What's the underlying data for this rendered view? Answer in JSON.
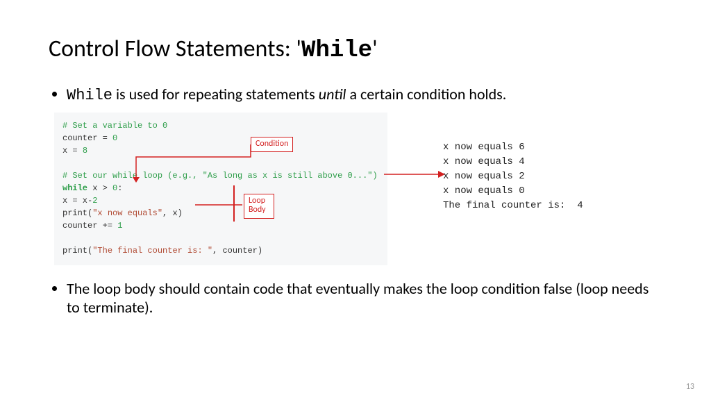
{
  "title": {
    "prefix": "Control Flow Statements: '",
    "keyword": "While",
    "suffix": "'"
  },
  "bullets": {
    "b1_code": "While",
    "b1_mid": " is used for repeating statements ",
    "b1_italic": "until",
    "b1_end": " a certain condition holds.",
    "b2": "The loop body should contain code that eventually makes the loop condition false (loop needs to terminate)."
  },
  "annotations": {
    "condition": "Condition",
    "loop_body_l1": "Loop",
    "loop_body_l2": "Body"
  },
  "code": {
    "l1": "# Set a variable to 0",
    "l2a": "counter = ",
    "l2b": "0",
    "l3a": "x = ",
    "l3b": "8",
    "l4": "",
    "l5": "# Set our while loop (e.g., \"As long as x is still above 0...\")",
    "l6a": "while",
    "l6b": " x > ",
    "l6c": "0",
    "l6d": ":",
    "l7a": "  x = x-",
    "l7b": "2",
    "l8a": "  ",
    "l8b": "print",
    "l8c": "(",
    "l8d": "\"x now equals\"",
    "l8e": ", x)",
    "l9a": "  counter += ",
    "l9b": "1",
    "l10": "",
    "l11a": "print",
    "l11b": "(",
    "l11c": "\"The final counter is: \"",
    "l11d": ", counter)"
  },
  "output": {
    "l1": "x now equals 6",
    "l2": "x now equals 4",
    "l3": "x now equals 2",
    "l4": "x now equals 0",
    "l5": "The final counter is:  4"
  },
  "page_number": "13"
}
